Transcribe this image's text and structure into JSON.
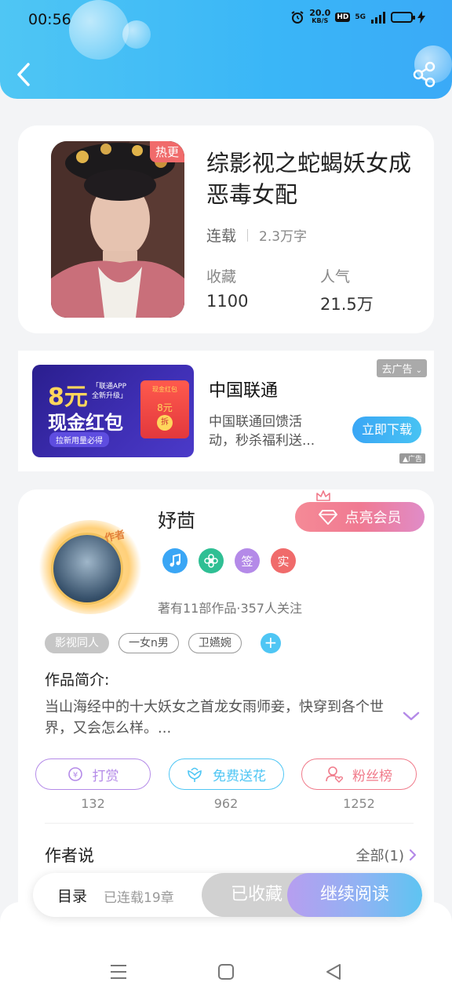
{
  "status_bar": {
    "time": "00:56",
    "speed_value": "20.0",
    "speed_unit": "KB/S",
    "hd": "HD",
    "network": "5G"
  },
  "header": {
    "back_icon": "chevron-left-icon",
    "share_icon": "share-icon",
    "gradient": [
      "#4fc6f4",
      "#3aaaf7"
    ]
  },
  "book": {
    "badge": "热更",
    "title": "综影视之蛇蝎妖女成恶毒女配",
    "status": "连载",
    "word_count": "2.3万字",
    "stats": [
      {
        "label": "收藏",
        "value": "1100"
      },
      {
        "label": "人气",
        "value": "21.5万"
      }
    ]
  },
  "ad": {
    "image_amount": "8元",
    "image_title": "现金红包",
    "image_sub1": "「联通APP",
    "image_sub2": "全新升级」",
    "image_footer": "拉新用量必得",
    "envelope_header": "现金红包",
    "envelope_amount": "8元",
    "envelope_coin": "拆",
    "title": "中国联通",
    "description": "中国联通回馈活动，秒杀福利送...",
    "close_label": "去广告",
    "cta_label": "立即下载",
    "mark": "广告"
  },
  "author": {
    "avatar_tag": "作者",
    "name": "妤茴",
    "vip_label": "点亮会员",
    "badges": [
      {
        "icon": "music-note-icon",
        "color": "#3aa6f5"
      },
      {
        "icon": "flower-icon",
        "color": "#2fbf94"
      },
      {
        "text": "签",
        "color": "#b48ae8"
      },
      {
        "text": "实",
        "color": "#f06b6b"
      }
    ],
    "meta": "著有11部作品·357人关注",
    "tags": [
      "影视同人",
      "一女n男",
      "卫嬿婉"
    ],
    "intro_label": "作品简介:",
    "intro_text": "当山海经中的十大妖女之首龙女雨师妾，快穿到各个世界，又会怎么样。...",
    "actions": [
      {
        "label": "打赏",
        "count": "132",
        "color": "#b48ae8",
        "icon": "yen-coin-icon"
      },
      {
        "label": "免费送花",
        "count": "962",
        "color": "#4fc6f4",
        "icon": "flower-icon"
      },
      {
        "label": "粉丝榜",
        "count": "1252",
        "color": "#f07a8a",
        "icon": "fan-user-icon"
      }
    ],
    "author_says_label": "作者说",
    "all_label": "全部(1)"
  },
  "read_bar": {
    "toc_label": "目录",
    "toc_status": "已连载19章",
    "fav_label": "已收藏",
    "continue_label": "继续阅读"
  },
  "system_nav": {
    "menu_icon": "menu-icon",
    "home_icon": "home-square-icon",
    "back_icon": "back-triangle-icon"
  }
}
